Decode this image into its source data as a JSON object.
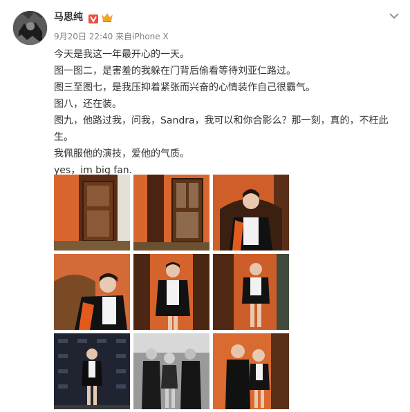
{
  "post": {
    "username": "马思纯",
    "verified_icon": "verified-v-icon",
    "member_icon": "member-crown-icon",
    "timestamp": "9月20日 22:40",
    "source_prefix": "来自",
    "source": "iPhone X",
    "lines": [
      "今天是我这一年最开心的一天。",
      "图一图二，是害羞的我躲在门背后偷看等待刘亚仁路过。",
      "图三至图七，是我压抑着紧张而兴奋的心情装作自己很霸气。",
      "图八，还在装。",
      "图九，他路过我，问我，Sandra，我可以和你合影么？那一刻，真的，不枉此生。",
      "我佩服他的演技，爱他的气质。",
      "yes，im big fan."
    ]
  },
  "colors": {
    "text": "#333333",
    "meta": "#808080",
    "verified": "#f5a623",
    "orange_wall": "#d8662e"
  },
  "photos": [
    {
      "id": "photo-1",
      "subject": "door-hiding"
    },
    {
      "id": "photo-2",
      "subject": "door-hiding"
    },
    {
      "id": "photo-3",
      "subject": "sitting-chair"
    },
    {
      "id": "photo-4",
      "subject": "sitting-chair"
    },
    {
      "id": "photo-5",
      "subject": "standing-jacket"
    },
    {
      "id": "photo-6",
      "subject": "standing-jacket"
    },
    {
      "id": "photo-7",
      "subject": "event-backdrop"
    },
    {
      "id": "photo-8",
      "subject": "group-bw"
    },
    {
      "id": "photo-9",
      "subject": "duo-photo"
    }
  ]
}
